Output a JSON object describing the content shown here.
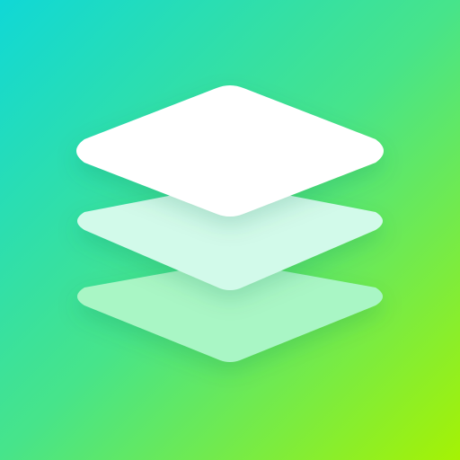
{
  "icon": {
    "semantic": "layers-icon",
    "colors": {
      "gradient_start": "#10D8D6",
      "gradient_mid": "#47E48A",
      "gradient_end": "#A5F204",
      "layer_top": "#FFFFFF",
      "layer_middle": "#D2FAEA",
      "layer_bottom": "#A9F6C5"
    }
  }
}
